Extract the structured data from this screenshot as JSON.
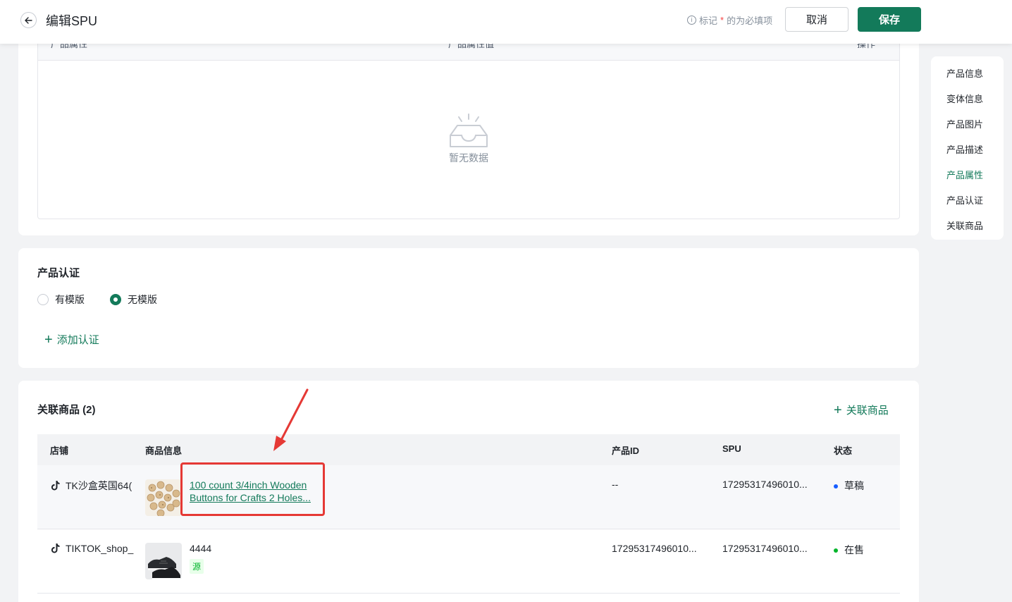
{
  "header": {
    "title": "编辑SPU",
    "required_hint_prefix": "标记",
    "required_hint_star": "*",
    "required_hint_suffix": "的为必填项",
    "cancel_label": "取消",
    "save_label": "保存"
  },
  "attributes_section": {
    "col_name": "产品属性",
    "col_value": "产品属性值",
    "col_action": "操作",
    "empty_text": "暂无数据"
  },
  "certification_section": {
    "title": "产品认证",
    "options": [
      {
        "label": "有模版",
        "checked": false
      },
      {
        "label": "无模版",
        "checked": true
      }
    ],
    "add_label": "添加认证"
  },
  "linked_goods_section": {
    "title": "关联商品 (2)",
    "add_label": "关联商品",
    "columns": [
      "店铺",
      "商品信息",
      "产品ID",
      "SPU",
      "状态"
    ],
    "rows": [
      {
        "shop": "TK沙盒英国64(",
        "product_title": "100 count 3/4inch Wooden Buttons for Crafts 2 Holes...",
        "product_id": "--",
        "spu": "17295317496010...",
        "status": "草稿",
        "status_color": "#165dff",
        "thumb": "wooden-buttons-thumbnail"
      },
      {
        "shop": "TIKTOK_shop_",
        "product_title": "4444",
        "tag": "源",
        "product_id": "17295317496010...",
        "spu": "17295317496010...",
        "status": "在售",
        "status_color": "#00b42a",
        "thumb": "black-sneakers-thumbnail"
      }
    ]
  },
  "anchor_nav": {
    "items": [
      "产品信息",
      "变体信息",
      "产品图片",
      "产品描述",
      "产品属性",
      "产品认证",
      "关联商品"
    ],
    "active": "产品属性"
  },
  "colors": {
    "primary": "#137a5a",
    "annotation_red": "#e53935"
  }
}
